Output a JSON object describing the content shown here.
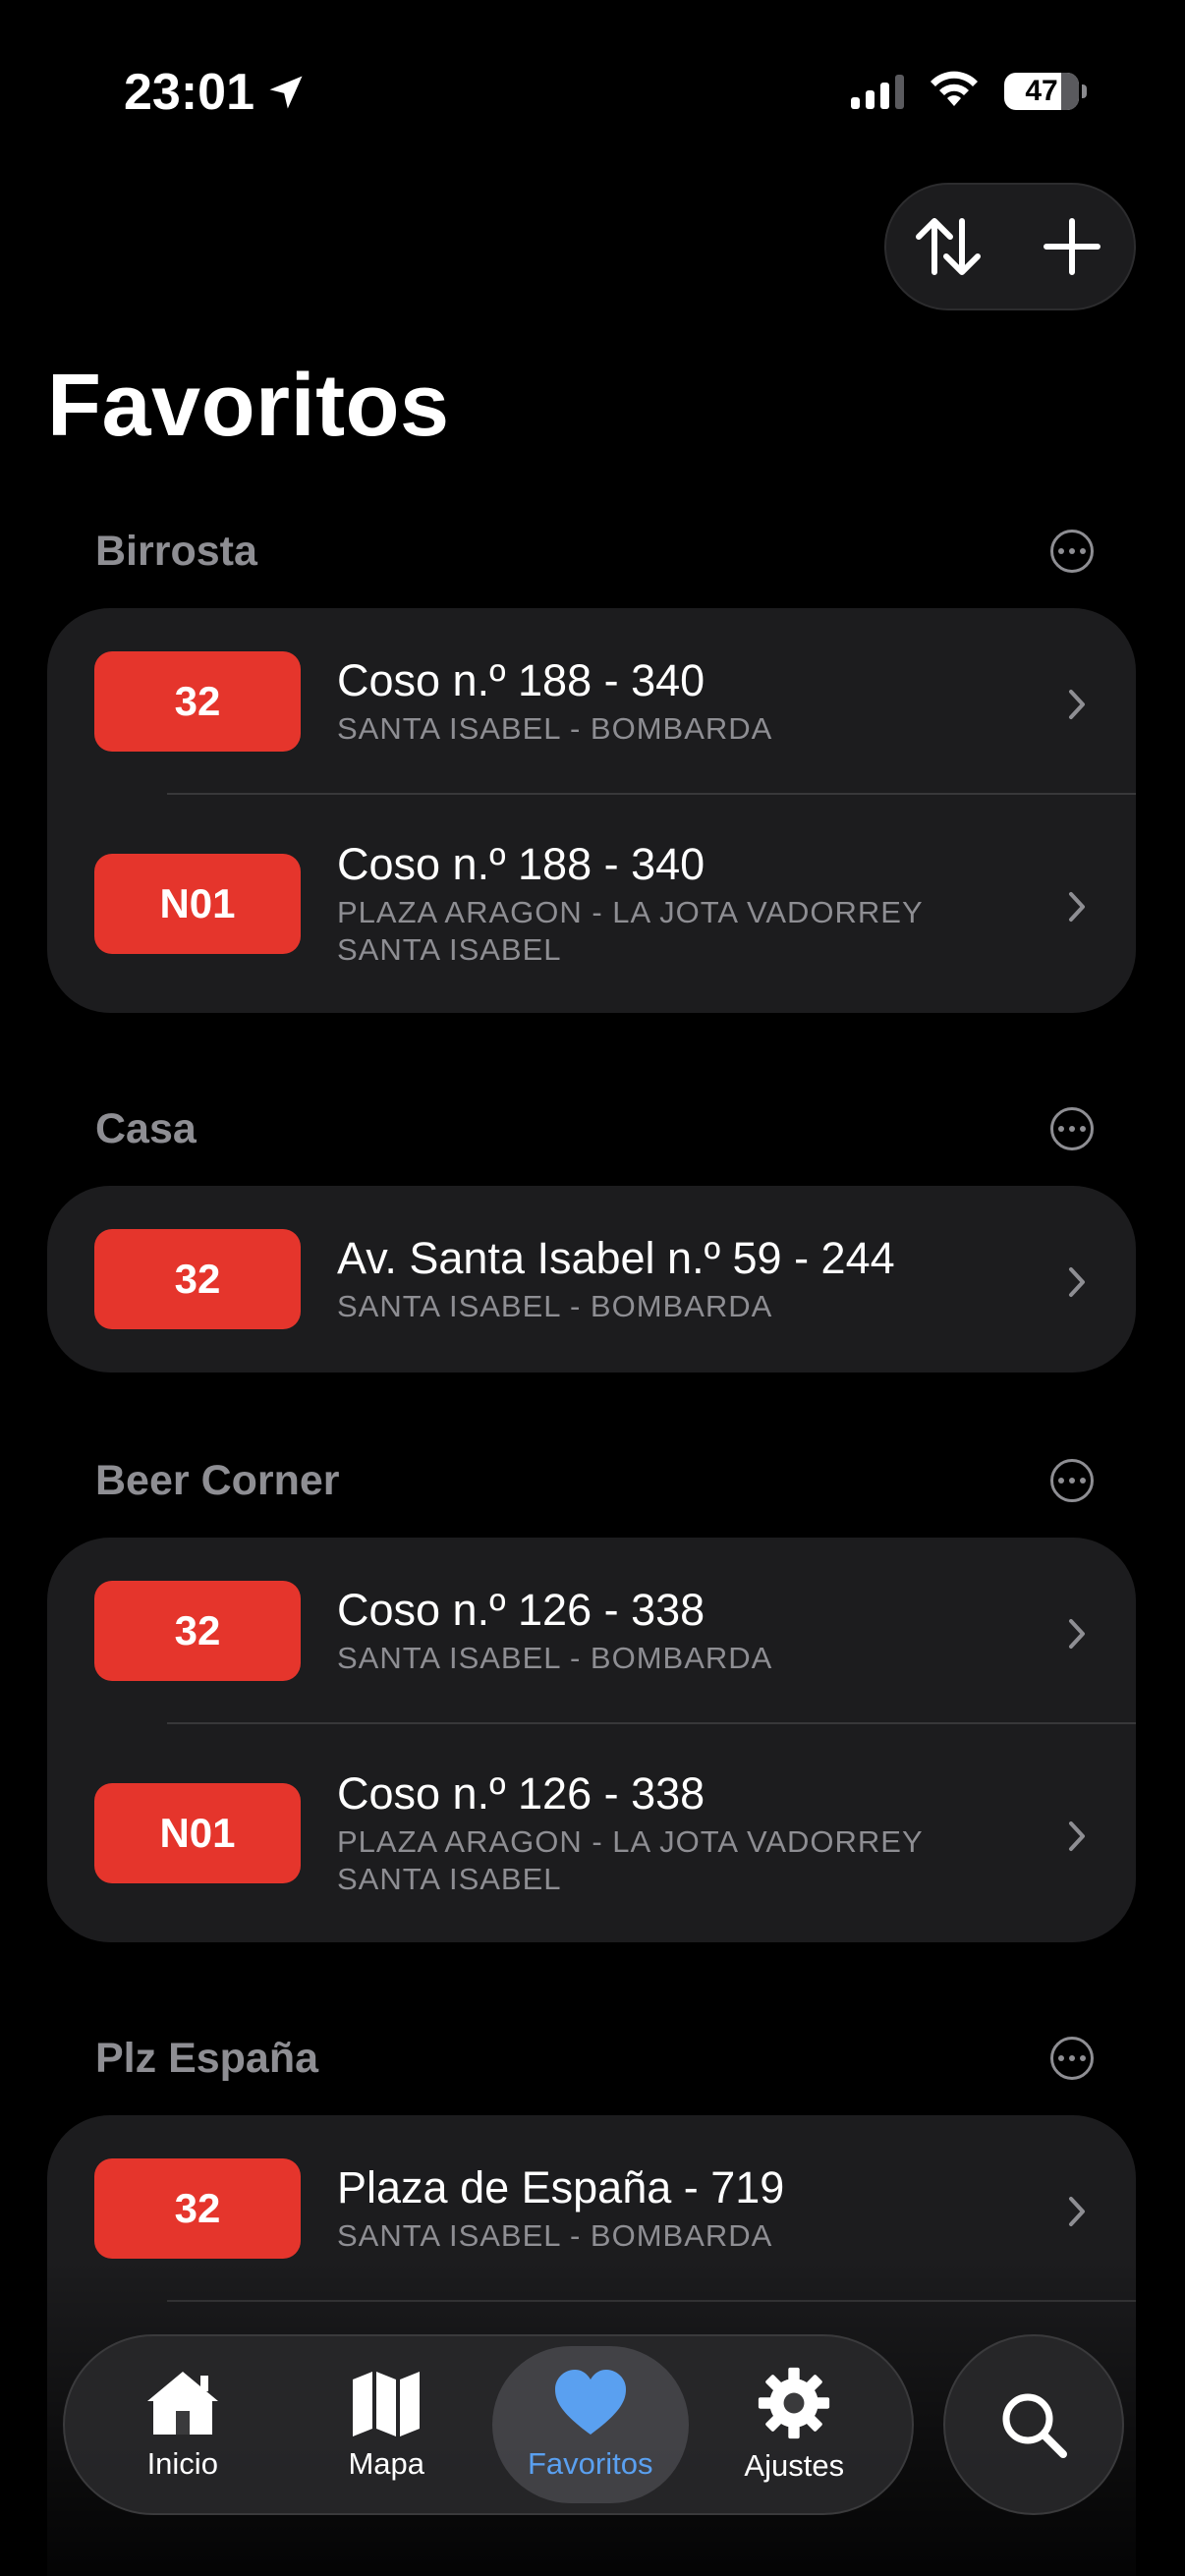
{
  "status_bar": {
    "time": "23:01",
    "battery": "47"
  },
  "page": {
    "title": "Favoritos"
  },
  "groups": [
    {
      "name": "Birrosta",
      "rows": [
        {
          "line": "32",
          "stop": "Coso n.º 188 - 340",
          "destination": [
            "SANTA ISABEL - BOMBARDA"
          ]
        },
        {
          "line": "N01",
          "stop": "Coso n.º 188 - 340",
          "destination": [
            "PLAZA ARAGON - LA JOTA  VADORREY",
            "SANTA ISABEL"
          ]
        }
      ]
    },
    {
      "name": "Casa",
      "rows": [
        {
          "line": "32",
          "stop": "Av. Santa Isabel n.º 59 - 244",
          "destination": [
            "SANTA ISABEL - BOMBARDA"
          ]
        }
      ]
    },
    {
      "name": "Beer Corner",
      "rows": [
        {
          "line": "32",
          "stop": "Coso n.º 126 - 338",
          "destination": [
            "SANTA ISABEL - BOMBARDA"
          ]
        },
        {
          "line": "N01",
          "stop": "Coso n.º 126 - 338",
          "destination": [
            "PLAZA ARAGON - LA JOTA  VADORREY",
            "SANTA ISABEL"
          ]
        }
      ]
    },
    {
      "name": "Plz España",
      "rows": [
        {
          "line": "32",
          "stop": "Plaza de España - 719",
          "destination": [
            "SANTA ISABEL - BOMBARDA"
          ]
        }
      ]
    }
  ],
  "tab_bar": {
    "items": [
      {
        "label": "Inicio",
        "icon": "house-icon",
        "active": false
      },
      {
        "label": "Mapa",
        "icon": "map-icon",
        "active": false
      },
      {
        "label": "Favoritos",
        "icon": "heart-icon",
        "active": true
      },
      {
        "label": "Ajustes",
        "icon": "gear-icon",
        "active": false
      }
    ]
  },
  "colors": {
    "background": "#000000",
    "card": "#1c1c1e",
    "badge": "#e5352c",
    "secondary_text": "#8e8e93",
    "active_tab": "#5aa0f0"
  }
}
